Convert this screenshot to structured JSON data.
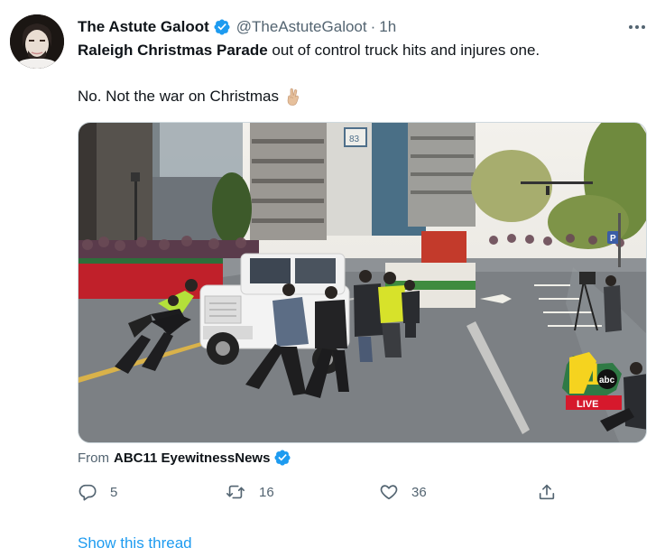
{
  "author": {
    "display_name": "The Astute Galoot",
    "handle": "@TheAstuteGaloot",
    "separator": "·",
    "time": "1h",
    "verified": true
  },
  "tweet": {
    "bold_text": "Raleigh Christmas Parade",
    "text_rest": " out of control truck hits and injures one.",
    "line2": "No. Not the war on Christmas"
  },
  "media": {
    "overlay_logo": "abc",
    "overlay_number": "11",
    "overlay_live": "LIVE",
    "building_sign": "83"
  },
  "source": {
    "from_label": "From",
    "name": "ABC11 EyewitnessNews",
    "verified": true
  },
  "actions": {
    "replies": "5",
    "retweets": "16",
    "likes": "36"
  },
  "show_thread": "Show this thread",
  "colors": {
    "accent": "#1d9bf0",
    "text": "#0f1419",
    "muted": "#536471",
    "abc_red": "#d6192c",
    "abc_yellow": "#f5d31f"
  },
  "icons": {
    "menu": "more-icon",
    "verified": "verified-badge-icon",
    "emoji": "crossed-fingers-emoji",
    "reply": "reply-icon",
    "retweet": "retweet-icon",
    "like": "like-icon",
    "share": "share-icon"
  }
}
